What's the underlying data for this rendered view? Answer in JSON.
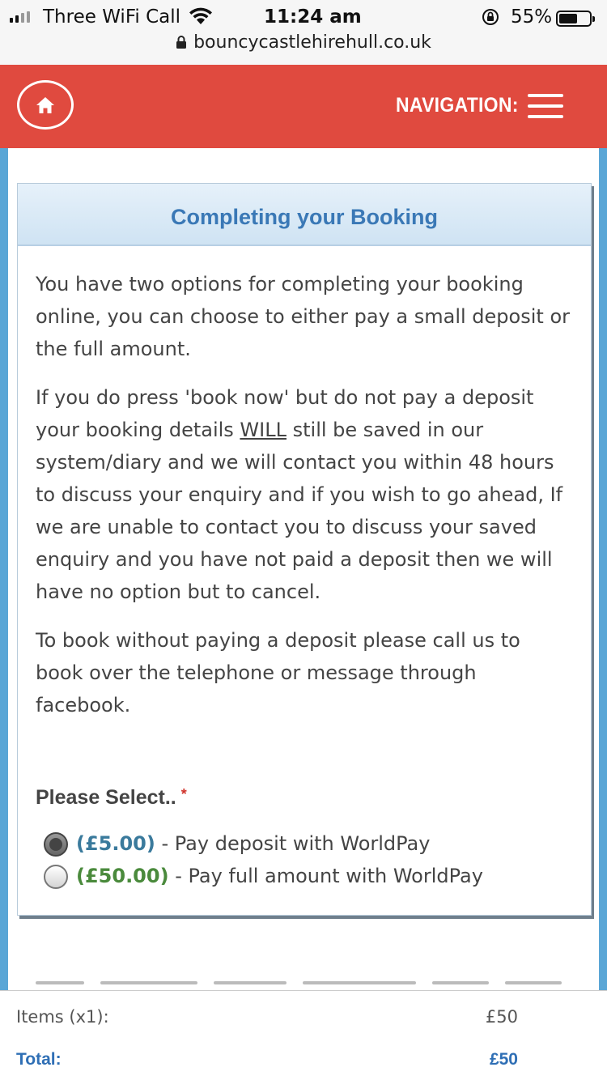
{
  "status_bar": {
    "carrier": "Three WiFi Call",
    "time": "11:24 am",
    "battery": "55%",
    "url": "bouncycastlehirehull.co.uk"
  },
  "header": {
    "nav_label": "NAVIGATION:"
  },
  "panel": {
    "title": "Completing your Booking",
    "para1": "You have two options for completing your booking online, you can choose to either pay a small deposit or the full amount.",
    "para2_a": "If you do press 'book now' but do not pay a deposit your booking details ",
    "para2_em": "WILL",
    "para2_b": " still be saved in our system/diary and we will contact you within 48 hours to discuss your enquiry and if you wish to go ahead, If we are unable to contact you to discuss your saved enquiry and you have not paid a deposit then we will have no option but to cancel.",
    "para3": "To book without paying a deposit please call us to book over the telephone or message through facebook.",
    "select_label": "Please Select..",
    "required_mark": "*",
    "options": [
      {
        "price": "(£5.00)",
        "text": " - Pay deposit with WorldPay",
        "selected": true
      },
      {
        "price": "(£50.00)",
        "text": " - Pay full amount with WorldPay",
        "selected": false
      }
    ]
  },
  "summary": {
    "items_label": "Items (x1):",
    "items_value": "£50",
    "total_label": "Total:",
    "total_value": "£50"
  },
  "colors": {
    "header": "#e04a3f",
    "title": "#3a78b6",
    "deposit_price": "#3a7a9c",
    "full_price": "#4a8a3c",
    "total": "#2f6fb5"
  }
}
